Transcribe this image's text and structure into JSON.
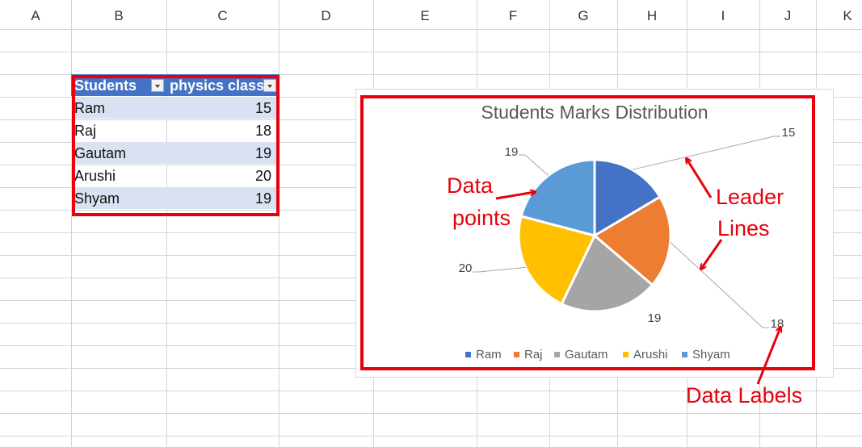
{
  "column_headers": [
    "A",
    "B",
    "C",
    "D",
    "E",
    "F",
    "G",
    "H",
    "I",
    "J",
    "K"
  ],
  "table": {
    "headers": [
      "Students",
      "physics class"
    ],
    "rows": [
      [
        "Ram",
        "15"
      ],
      [
        "Raj",
        "18"
      ],
      [
        "Gautam",
        "19"
      ],
      [
        "Arushi",
        "20"
      ],
      [
        "Shyam",
        "19"
      ]
    ]
  },
  "chart_data": {
    "type": "pie",
    "title": "Students Marks Distribution",
    "categories": [
      "Ram",
      "Raj",
      "Gautam",
      "Arushi",
      "Shyam"
    ],
    "values": [
      15,
      18,
      19,
      20,
      19
    ],
    "data_labels": [
      "15",
      "18",
      "19",
      "20",
      "19"
    ],
    "colors": [
      "#4472c4",
      "#ed7d31",
      "#a5a5a5",
      "#ffc000",
      "#5b9bd5"
    ],
    "legend_placement": "bottom",
    "leader_lines": true
  },
  "annotations": {
    "data_points": [
      "Data",
      "points"
    ],
    "leader_lines": [
      "Leader",
      "Lines"
    ],
    "data_labels": "Data Labels",
    "color": "#e8000b"
  }
}
